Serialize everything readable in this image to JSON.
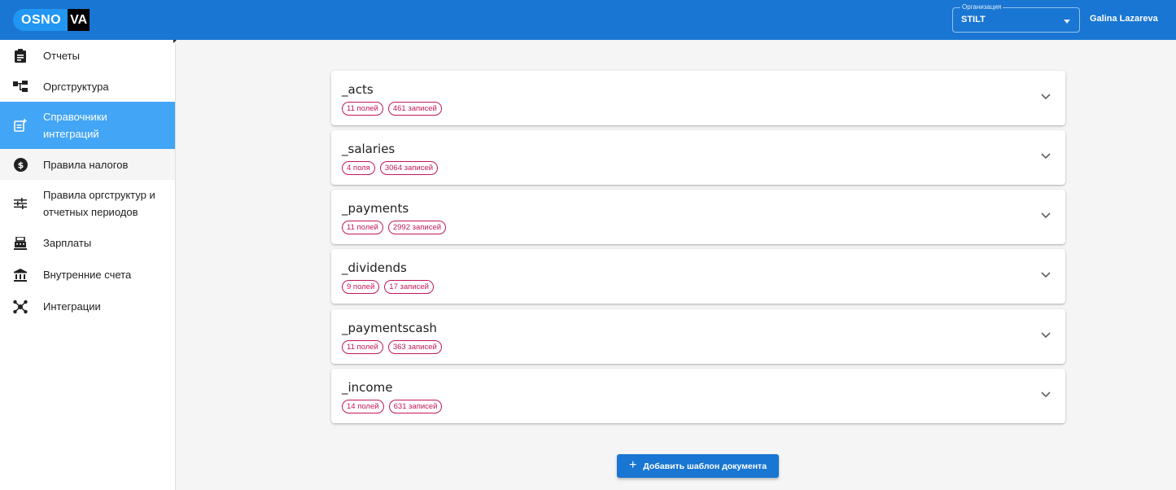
{
  "logo": {
    "left": "OSNO",
    "right": "VA"
  },
  "header": {
    "org_label": "Организация",
    "org_value": "STILT",
    "user_name": "Galina Lazareva"
  },
  "sidebar": {
    "items": [
      {
        "label": "Отчеты",
        "icon": "clipboard-icon"
      },
      {
        "label": "Оргструктура",
        "icon": "org-structure-icon"
      },
      {
        "label": "Справочники интеграций",
        "icon": "post-add-icon"
      },
      {
        "label": "Правила налогов",
        "icon": "dollar-circle-icon"
      },
      {
        "label": "Правила оргструктур и отчетных периодов",
        "icon": "tune-icon"
      },
      {
        "label": "Зарплаты",
        "icon": "register-icon"
      },
      {
        "label": "Внутренние счета",
        "icon": "bank-icon"
      },
      {
        "label": "Интеграции",
        "icon": "network-icon"
      }
    ],
    "label_lines": [
      [
        "Отчеты"
      ],
      [
        "Оргструктура"
      ],
      [
        "Справочники",
        "интеграций"
      ],
      [
        "Правила налогов"
      ],
      [
        "Правила оргструктур и",
        "отчетных периодов"
      ],
      [
        "Зарплаты"
      ],
      [
        "Внутренние счета"
      ],
      [
        "Интеграции"
      ]
    ]
  },
  "templates": [
    {
      "name": "_acts",
      "fields": "11 полей",
      "records": "461 записей"
    },
    {
      "name": "_salaries",
      "fields": "4 поля",
      "records": "3064 записей"
    },
    {
      "name": "_payments",
      "fields": "11 полей",
      "records": "2992 записей"
    },
    {
      "name": "_dividends",
      "fields": "9 полей",
      "records": "17 записей"
    },
    {
      "name": "_paymentscash",
      "fields": "11 полей",
      "records": "363 записей"
    },
    {
      "name": "_income",
      "fields": "14 полей",
      "records": "631 записей"
    }
  ],
  "add_button": {
    "label": "Добавить шаблон документа",
    "icon": "plus-icon"
  },
  "colors": {
    "header": "#1976d2",
    "active_nav": "#42a5f5",
    "chip": "#c2185b"
  }
}
